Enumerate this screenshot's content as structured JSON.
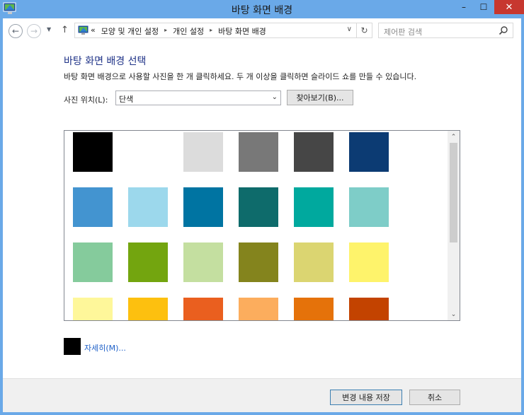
{
  "window": {
    "title": "바탕 화면 배경",
    "minimize_label": "–",
    "maximize_label": "☐",
    "close_label": "✕"
  },
  "navigation": {
    "back_glyph": "←",
    "forward_glyph": "→",
    "recent_glyph": "▼",
    "up_glyph": "↑",
    "address": {
      "overflow": "«",
      "crumbs": [
        "모양 및 개인 설정",
        "개인 설정",
        "바탕 화면 배경"
      ],
      "separator": "▸",
      "dropdown_glyph": "∨",
      "refresh_glyph": "↻"
    },
    "search": {
      "placeholder": "제어판 검색",
      "icon": "search-icon"
    }
  },
  "content": {
    "heading": "바탕 화면 배경 선택",
    "description": "바탕 화면 배경으로 사용할 사진을 한 개 클릭하세요. 두 개 이상을 클릭하면 슬라이드 쇼를 만들 수 있습니다.",
    "location_label": "사진 위치(L):",
    "location_value": "단색",
    "location_arrow": "⌄",
    "browse_label": "찾아보기(B)...",
    "swatch_rows": [
      [
        "#000000",
        "#ffffff",
        "#dcdcdc",
        "#787878",
        "#464646",
        "#0c3b73"
      ],
      [
        "#4394d0",
        "#9cd8ec",
        "#0074a2",
        "#0e6b6b",
        "#00a99e",
        "#7ecdc8"
      ],
      [
        "#85cb9c",
        "#73a50f",
        "#c4dfa0",
        "#84841d",
        "#dbd571",
        "#fef36b"
      ],
      [
        "#fef79a",
        "#fdc00f",
        "#ea5f1f",
        "#fcad5d",
        "#e5720a",
        "#c34300"
      ]
    ],
    "selected_color": "#000000",
    "detail_link": "자세히(M)...",
    "scroll_up_glyph": "⌃",
    "scroll_down_glyph": "⌄"
  },
  "footer": {
    "save_label": "변경 내용 저장",
    "cancel_label": "취소"
  },
  "colors": {
    "title_bar": "#6aa9e8",
    "heading": "#1e3287",
    "link": "#1e60c8",
    "close_button": "#c7372f"
  }
}
